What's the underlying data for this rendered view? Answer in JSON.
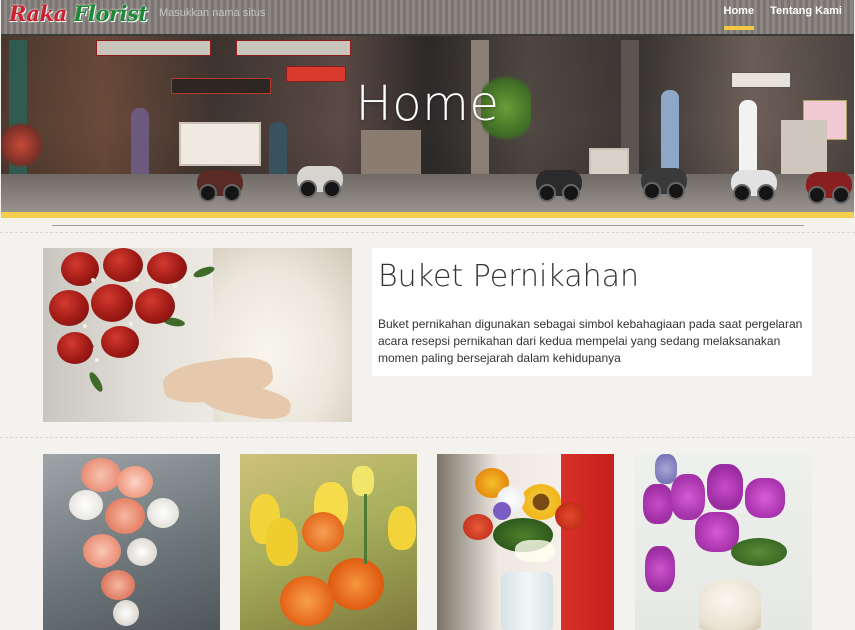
{
  "header": {
    "logo_part1": "Raka",
    "logo_part2": "Florist",
    "search": {
      "placeholder": "Masukkan nama situs",
      "value": ""
    },
    "nav": [
      {
        "label": "Home",
        "active": true
      },
      {
        "label": "Tentang Kami",
        "active": false
      }
    ]
  },
  "hero": {
    "title": "Home"
  },
  "feature": {
    "image_alt": "wedding-bouquet",
    "title": "Buket Pernikahan",
    "description": "Buket pernikahan digunakan sebagai simbol kebahagiaan pada saat pergelaran acara resepsi pernikahan dari kedua mempelai yang sedang melaksanakan momen paling bersejarah dalam kehidupanya"
  },
  "gallery": [
    {
      "name": "peach-rose-cascade"
    },
    {
      "name": "yellow-tulip-orange-rose"
    },
    {
      "name": "mixed-sunflower-vase"
    },
    {
      "name": "purple-stock-vase"
    }
  ],
  "colors": {
    "accent": "#f3cf4d",
    "logo_red": "#cf1f2e",
    "logo_green": "#1c8a34",
    "background": "#f4f2ee"
  },
  "icons": []
}
